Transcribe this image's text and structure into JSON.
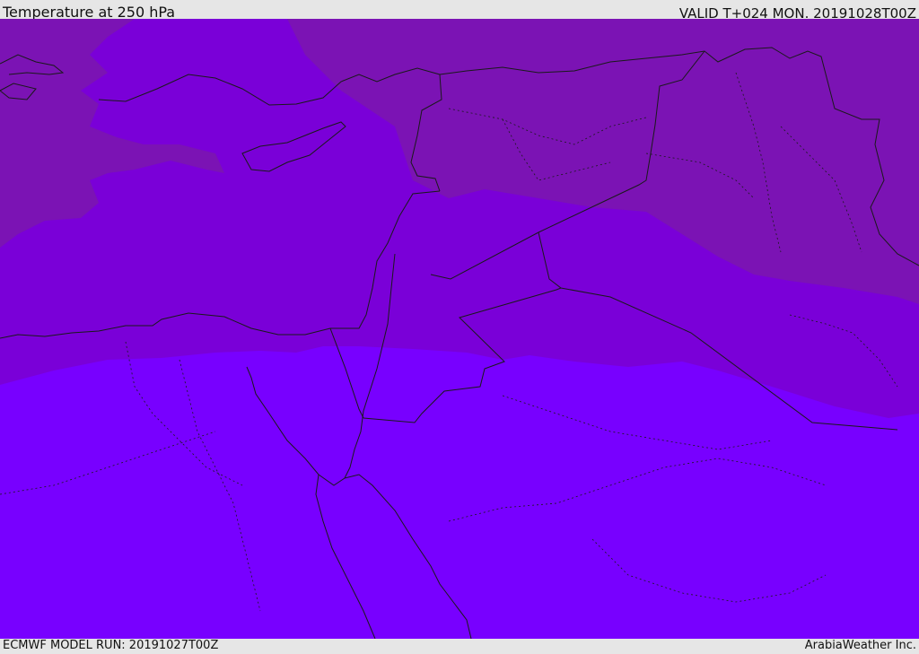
{
  "header": {
    "title": "Temperature at 250 hPa",
    "valid": "VALID T+024 MON. 20191028T00Z"
  },
  "footer": {
    "model_run": "ECMWF MODEL RUN: 20191027T00Z",
    "credit": "ArabiaWeather Inc."
  },
  "map": {
    "colors": {
      "band_cold_dark": "#7b13b4",
      "band_mid": "#7a00d8",
      "band_warm": "#7800ff",
      "borders": "#1a1a1a"
    }
  }
}
